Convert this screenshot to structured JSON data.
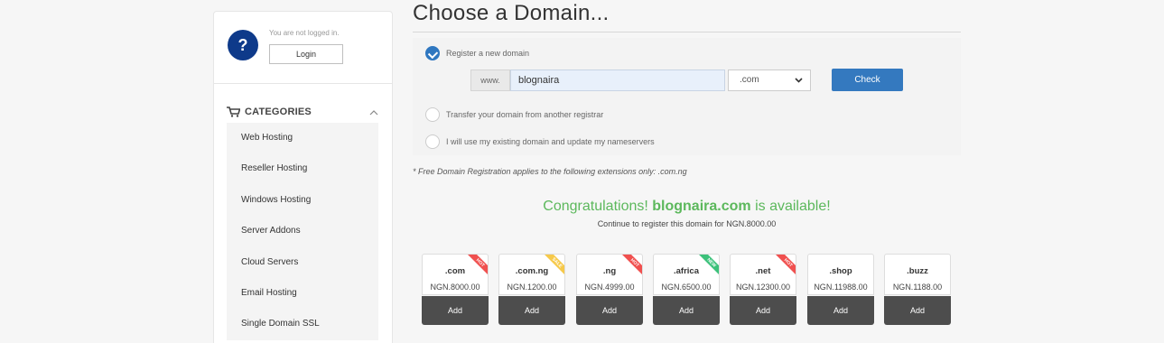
{
  "sidebar": {
    "help_icon": "question-circle-icon",
    "not_logged_in": "You are not logged in.",
    "login_label": "Login",
    "categories_title": "CATEGORIES",
    "categories": [
      {
        "label": "Web Hosting"
      },
      {
        "label": "Reseller Hosting"
      },
      {
        "label": "Windows Hosting"
      },
      {
        "label": "Server Addons"
      },
      {
        "label": "Cloud Servers"
      },
      {
        "label": "Email Hosting"
      },
      {
        "label": "Single Domain SSL"
      }
    ]
  },
  "main": {
    "title": "Choose a Domain...",
    "options": {
      "register": "Register a new domain",
      "transfer": "Transfer your domain from another registrar",
      "existing": "I will use my existing domain and update my nameservers"
    },
    "selected_option": "register",
    "www_prefix": "www.",
    "domain_value": "blognaira",
    "tld_selected": ".com",
    "check_label": "Check",
    "free_note": "* Free Domain Registration applies to the following extensions only: .com.ng",
    "congrats_prefix": "Congratulations!",
    "congrats_domain": "blognaira.com",
    "congrats_suffix": "is available!",
    "continue_text": "Continue to register this domain for NGN.8000.00"
  },
  "tld_suggestions": [
    {
      "tld": ".com",
      "price": "NGN.8000.00",
      "add": "Add",
      "badge": "HOT",
      "badge_color": "#f0504f"
    },
    {
      "tld": ".com.ng",
      "price": "NGN.1200.00",
      "add": "Add",
      "badge": "SALE",
      "badge_color": "#f6c94a"
    },
    {
      "tld": ".ng",
      "price": "NGN.4999.00",
      "add": "Add",
      "badge": "HOT",
      "badge_color": "#f0504f"
    },
    {
      "tld": ".africa",
      "price": "NGN.6500.00",
      "add": "Add",
      "badge": "NEW",
      "badge_color": "#3cc17a"
    },
    {
      "tld": ".net",
      "price": "NGN.12300.00",
      "add": "Add",
      "badge": "HOT",
      "badge_color": "#f0504f"
    },
    {
      "tld": ".shop",
      "price": "NGN.11988.00",
      "add": "Add",
      "badge": "",
      "badge_color": ""
    },
    {
      "tld": ".buzz",
      "price": "NGN.1188.00",
      "add": "Add",
      "badge": "",
      "badge_color": ""
    }
  ],
  "colors": {
    "accent": "#3479bf",
    "success": "#5cb85c",
    "help_icon_bg": "#0e3a8a",
    "add_button": "#4d4d4d"
  }
}
